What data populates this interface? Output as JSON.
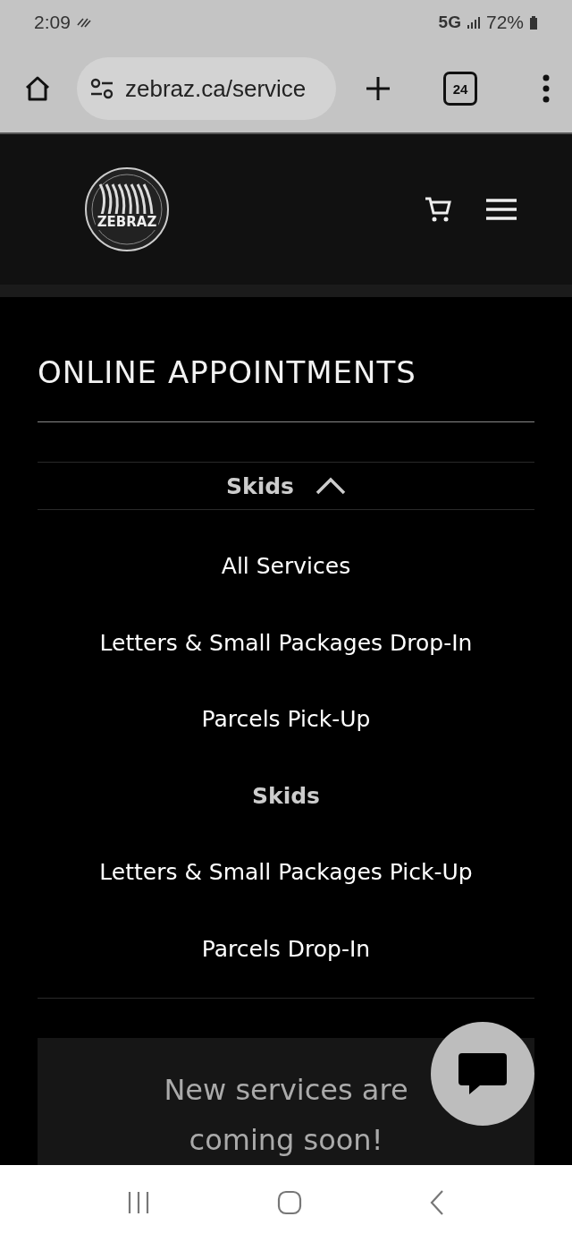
{
  "status_bar": {
    "time": "2:09",
    "network": "5G",
    "battery": "72%"
  },
  "browser": {
    "url": "zebraz.ca/service",
    "tab_count": "24"
  },
  "header": {
    "logo_text": "ZEBRAZ"
  },
  "page": {
    "title": "ONLINE APPOINTMENTS",
    "dropdown": {
      "label": "Skids",
      "expanded": true
    },
    "services": [
      {
        "label": "All Services",
        "selected": false
      },
      {
        "label": "Letters & Small Packages Drop-In",
        "selected": false
      },
      {
        "label": "Parcels Pick-Up",
        "selected": false
      },
      {
        "label": "Skids",
        "selected": true
      },
      {
        "label": "Letters & Small Packages Pick-Up",
        "selected": false
      },
      {
        "label": "Parcels Drop-In",
        "selected": false
      }
    ],
    "notice": "New services are coming soon!"
  }
}
